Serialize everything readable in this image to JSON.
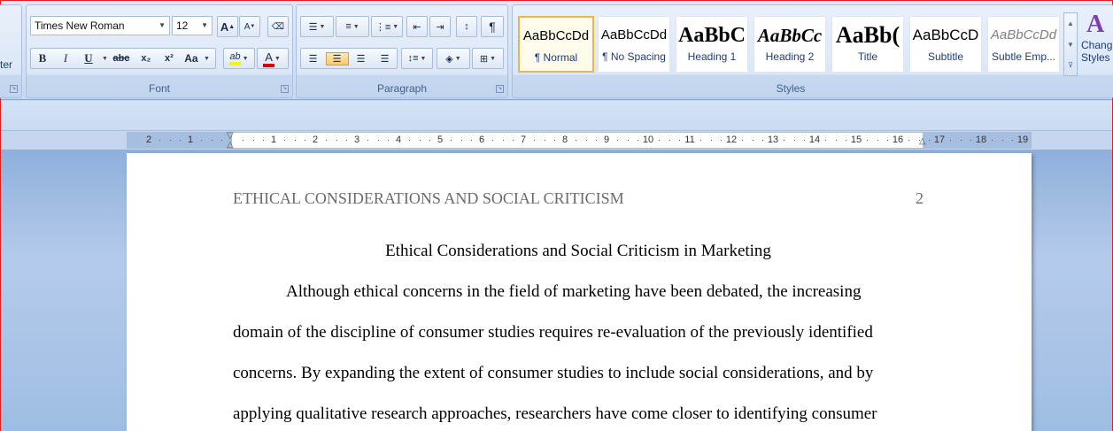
{
  "ribbon": {
    "clipboard_fragment": "ter",
    "font": {
      "group_label": "Font",
      "font_name": "Times New Roman",
      "font_size": "12",
      "grow_label": "A",
      "shrink_label": "A",
      "bold": "B",
      "italic": "I",
      "underline": "U",
      "strikethrough": "abc",
      "subscript": "x₂",
      "superscript": "x²",
      "change_case": "Aa",
      "highlight": "ab",
      "font_color": "A",
      "highlight_color": "#f6f600",
      "font_color_value": "#e00000"
    },
    "paragraph": {
      "group_label": "Paragraph",
      "pilcrow": "¶"
    },
    "styles": {
      "group_label": "Styles",
      "tiles": [
        {
          "sample": "AaBbCcDd",
          "name": "¶ Normal"
        },
        {
          "sample": "AaBbCcDd",
          "name": "¶ No Spacing"
        },
        {
          "sample": "AaBbC",
          "name": "Heading 1"
        },
        {
          "sample": "AaBbCc",
          "name": "Heading 2"
        },
        {
          "sample": "AaBb(",
          "name": "Title"
        },
        {
          "sample": "AaBbCcD",
          "name": "Subtitle"
        },
        {
          "sample": "AaBbCcDd",
          "name": "Subtle Emp..."
        }
      ],
      "change_styles_line1": "Chang",
      "change_styles_line2": "Styles"
    }
  },
  "ruler": {
    "labels_left": [
      "2",
      "1"
    ],
    "labels_right": [
      "1",
      "2",
      "3",
      "4",
      "5",
      "6",
      "7",
      "8",
      "9",
      "10",
      "11",
      "12",
      "13",
      "14",
      "15",
      "16",
      "17",
      "18",
      "19"
    ]
  },
  "document": {
    "header_text": "ETHICAL CONSIDERATIONS AND SOCIAL CRITICISM",
    "page_number": "2",
    "title": "Ethical Considerations and Social Criticism in Marketing",
    "lines": [
      "Although ethical concerns in the field of marketing have been debated, the increasing",
      "domain of the discipline of consumer studies requires re-evaluation of the previously identified",
      "concerns. By expanding the extent of consumer studies to include social considerations, and by",
      "applying qualitative research approaches, researchers have come  closer to identifying consumer"
    ]
  }
}
